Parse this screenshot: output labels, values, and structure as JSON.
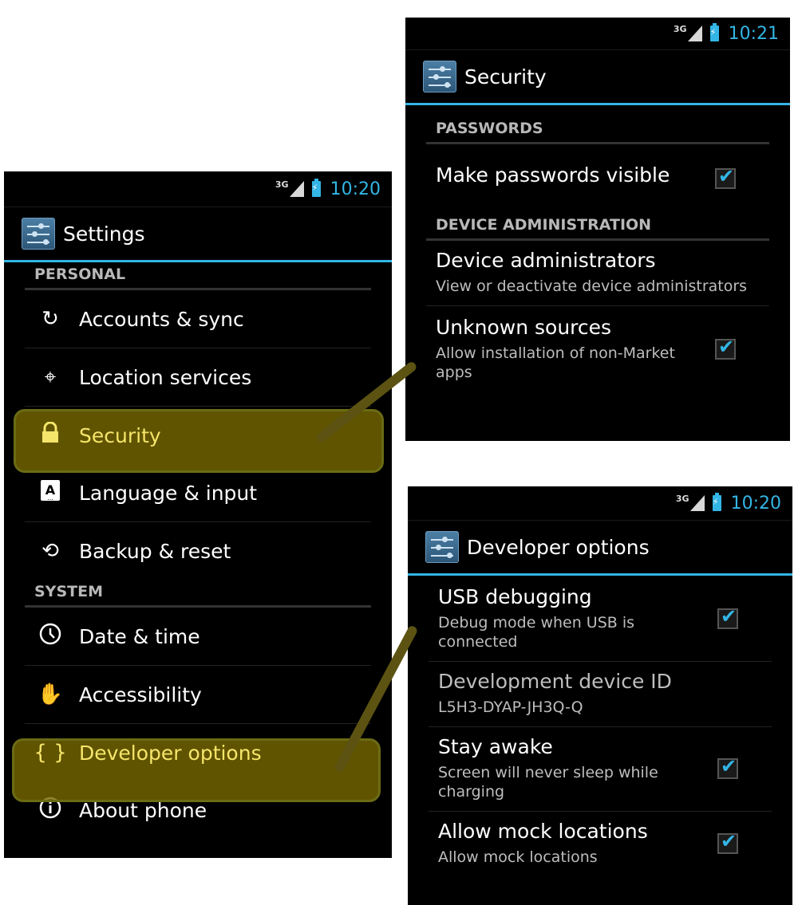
{
  "left_phone": {
    "status_bar": {
      "network": "3G",
      "time": "10:20"
    },
    "title": "Settings",
    "sections": [
      {
        "header": "PERSONAL",
        "items": [
          {
            "label": "Accounts & sync",
            "icon": "sync-icon"
          },
          {
            "label": "Location services",
            "icon": "location-icon"
          },
          {
            "label": "Security",
            "icon": "lock-icon",
            "highlighted": true
          },
          {
            "label": "Language & input",
            "icon": "keyboard-icon"
          },
          {
            "label": "Backup & reset",
            "icon": "backup-icon"
          }
        ]
      },
      {
        "header": "SYSTEM",
        "items": [
          {
            "label": "Date & time",
            "icon": "clock-icon"
          },
          {
            "label": "Accessibility",
            "icon": "hand-icon"
          },
          {
            "label": "Developer options",
            "icon": "braces-icon",
            "highlighted": true
          },
          {
            "label": "About phone",
            "icon": "info-icon"
          }
        ]
      }
    ]
  },
  "security_phone": {
    "status_bar": {
      "network": "3G",
      "time": "10:21"
    },
    "title": "Security",
    "passwords_header": "PASSWORDS",
    "make_passwords_visible": {
      "title": "Make passwords visible",
      "checked": true
    },
    "device_admin_header": "DEVICE ADMINISTRATION",
    "device_administrators": {
      "title": "Device administrators",
      "summary": "View or deactivate device administrators"
    },
    "unknown_sources": {
      "title": "Unknown sources",
      "summary": "Allow installation of non-Market apps",
      "checked": true
    }
  },
  "developer_phone": {
    "status_bar": {
      "network": "3G",
      "time": "10:20"
    },
    "title": "Developer options",
    "usb_debugging": {
      "title": "USB debugging",
      "summary": "Debug mode when USB is connected",
      "checked": true
    },
    "device_id": {
      "title": "Development device ID",
      "summary": "L5H3-DYAP-JH3Q-Q"
    },
    "stay_awake": {
      "title": "Stay awake",
      "summary": "Screen will never sleep while charging",
      "checked": true
    },
    "mock_locations": {
      "title": "Allow mock locations",
      "summary": "Allow mock locations",
      "checked": true
    }
  },
  "colors": {
    "accent": "#33b5e5",
    "highlight": "#786900",
    "background": "#000000"
  }
}
